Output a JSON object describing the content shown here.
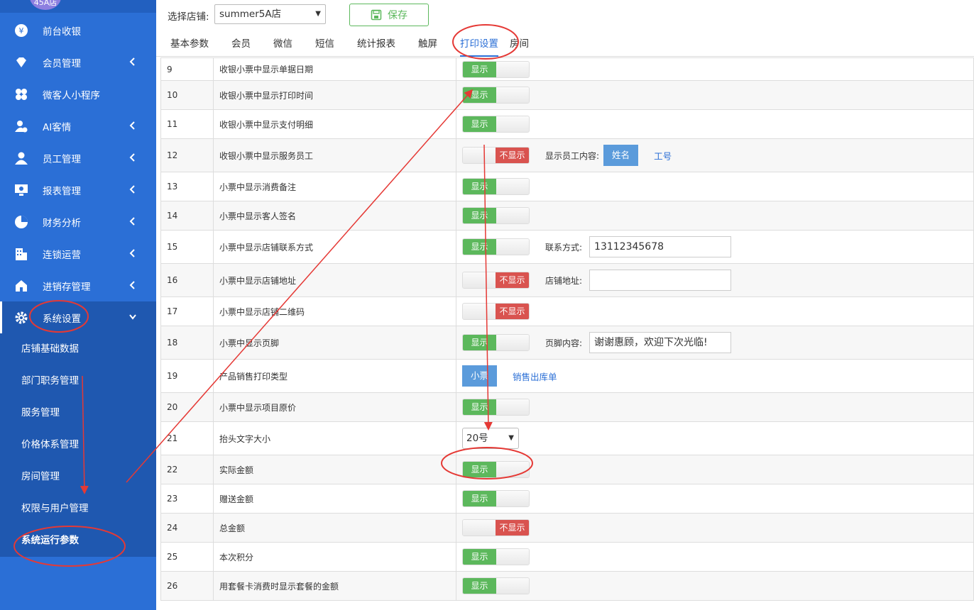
{
  "sidebar": {
    "avatar_text": "45A店",
    "items": [
      {
        "label": "前台收银",
        "icon": "yen-icon",
        "chevron": false
      },
      {
        "label": "会员管理",
        "icon": "diamond-icon",
        "chevron": true
      },
      {
        "label": "微客人小程序",
        "icon": "clover-icon",
        "chevron": false
      },
      {
        "label": "AI客情",
        "icon": "user-heart-icon",
        "chevron": true
      },
      {
        "label": "员工管理",
        "icon": "user-icon",
        "chevron": true
      },
      {
        "label": "报表管理",
        "icon": "monitor-icon",
        "chevron": true
      },
      {
        "label": "财务分析",
        "icon": "pie-chart-icon",
        "chevron": true
      },
      {
        "label": "连锁运营",
        "icon": "building-icon",
        "chevron": true
      },
      {
        "label": "进销存管理",
        "icon": "warehouse-icon",
        "chevron": true
      },
      {
        "label": "系统设置",
        "icon": "gear-icon",
        "chevron": true
      }
    ],
    "subitems": [
      "店铺基础数据",
      "部门职务管理",
      "服务管理",
      "价格体系管理",
      "房间管理",
      "权限与用户管理",
      "系统运行参数"
    ]
  },
  "header": {
    "store_label": "选择店铺:",
    "store_value": "summer5A店",
    "save_label": "保存"
  },
  "tabs": [
    "基本参数",
    "会员",
    "微信",
    "短信",
    "统计报表",
    "触屏",
    "打印设置",
    "房间"
  ],
  "active_tab": "打印设置",
  "toggle_labels": {
    "on": "显示",
    "off": "不显示"
  },
  "rows": [
    {
      "no": "9",
      "name": "收银小票中显示单据日期",
      "state": "on"
    },
    {
      "no": "10",
      "name": "收银小票中显示打印时间",
      "state": "on"
    },
    {
      "no": "11",
      "name": "收银小票中显示支付明细",
      "state": "on"
    },
    {
      "no": "12",
      "name": "收银小票中显示服务员工",
      "state": "off",
      "ext_label": "显示员工内容:",
      "ext_btn": "姓名",
      "ext_link": "工号"
    },
    {
      "no": "13",
      "name": "小票中显示消费备注",
      "state": "on"
    },
    {
      "no": "14",
      "name": "小票中显示客人签名",
      "state": "on"
    },
    {
      "no": "15",
      "name": "小票中显示店铺联系方式",
      "state": "on",
      "ext_label": "联系方式:",
      "ext_input": "13112345678"
    },
    {
      "no": "16",
      "name": "小票中显示店铺地址",
      "state": "off",
      "ext_label": "店铺地址:",
      "ext_input": ""
    },
    {
      "no": "17",
      "name": "小票中显示店铺二维码",
      "state": "off"
    },
    {
      "no": "18",
      "name": "小票中显示页脚",
      "state": "on",
      "ext_label": "页脚内容:",
      "ext_input": "谢谢惠顾，欢迎下次光临!"
    },
    {
      "no": "19",
      "name": "产品销售打印类型",
      "state": "type",
      "ext_btn": "小票",
      "ext_link": "销售出库单"
    },
    {
      "no": "20",
      "name": "小票中显示项目原价",
      "state": "on"
    },
    {
      "no": "21",
      "name": "抬头文字大小",
      "state": "select",
      "select_value": "20号"
    },
    {
      "no": "22",
      "name": "实际金额",
      "state": "on"
    },
    {
      "no": "23",
      "name": "赠送金额",
      "state": "on"
    },
    {
      "no": "24",
      "name": "总金额",
      "state": "off"
    },
    {
      "no": "25",
      "name": "本次积分",
      "state": "on"
    },
    {
      "no": "26",
      "name": "用套餐卡消费时显示套餐的金额",
      "state": "on"
    }
  ],
  "colors": {
    "sidebar": "#2b6fd6",
    "accent": "#2b6fd6",
    "on": "#5cb85c",
    "off": "#d9534f",
    "annotation": "#e53935"
  }
}
